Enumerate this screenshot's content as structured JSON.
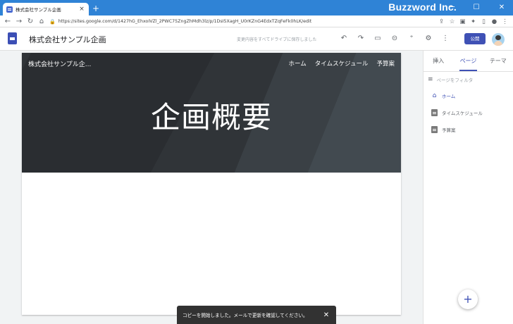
{
  "browser": {
    "tab_title": "株式会社サンプル企画",
    "tab_close": "×",
    "new_tab": "+",
    "brand": "Buzzword Inc.",
    "window_controls": {
      "minimize": "─",
      "maximize": "☐",
      "close": "✕"
    },
    "nav": {
      "back": "←",
      "forward": "→",
      "reload": "↻",
      "home": "⌂"
    },
    "lock_icon": "🔒",
    "url": "https://sites.google.com/d/1427hG_EhxoIVZl_2PWC75ZngZhMdh3lz/p/1DsI5XagH_U0rKZnG4EdxTZqFeFk0hLK/edit",
    "addr_icons": [
      "share-icon",
      "star-icon",
      "extension-icon",
      "puzzle-icon",
      "sidebar-icon",
      "account-icon",
      "menu-icon"
    ]
  },
  "app_header": {
    "site_title": "株式会社サンプル企画",
    "saved_message": "変更内容をすべてドライブに保存しました",
    "icons": {
      "undo": "↶",
      "redo": "↷",
      "preview": "▭",
      "link": "⊝",
      "share": "⁺",
      "settings": "⚙",
      "more": "⋮"
    },
    "publish_label": "公開"
  },
  "page": {
    "site_name": "株式会社サンプル企...",
    "nav": [
      "ホーム",
      "タイムスケジュール",
      "予算案"
    ],
    "hero_title": "企画概要"
  },
  "panel": {
    "tabs": [
      "挿入",
      "ページ",
      "テーマ"
    ],
    "active_tab": 1,
    "filter_placeholder": "ページをフィルタ",
    "pages": [
      {
        "label": "ホーム",
        "icon": "home-icon",
        "active": true
      },
      {
        "label": "タイムスケジュール",
        "icon": "page-icon",
        "active": false
      },
      {
        "label": "予算案",
        "icon": "page-icon",
        "active": false
      }
    ],
    "fab_label": "+"
  },
  "snackbar": {
    "message": "コピーを開始しました。メールで更新を確認してください。",
    "close": "✕"
  }
}
